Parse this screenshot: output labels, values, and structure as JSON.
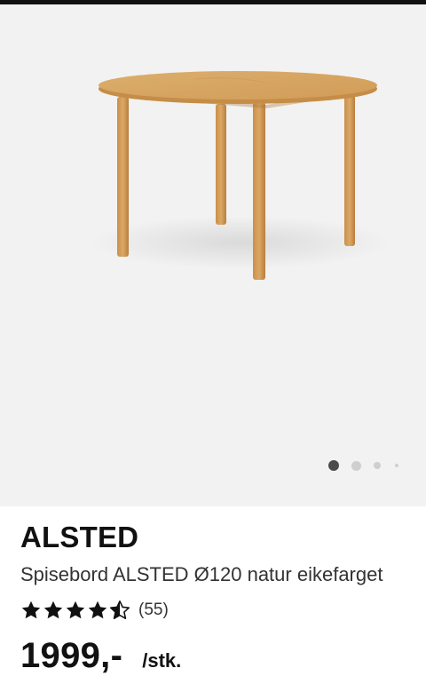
{
  "product": {
    "image_icon": "round-dining-table-image",
    "gallery_dots": [
      {
        "active": true
      },
      {
        "active": false
      },
      {
        "active": false
      },
      {
        "active": false
      }
    ],
    "brand": "ALSTED",
    "description": "Spisebord ALSTED Ø120 natur eikefarget",
    "rating": {
      "stars": 4.5,
      "max_stars": 5,
      "count_text": "(55)"
    },
    "price": "1999,-",
    "unit": "/stk."
  },
  "colors": {
    "gallery_background": "#f2f2f2",
    "active_dot": "#4a4a4a",
    "inactive_dot": "#cfcfcf",
    "wood": "#d6a25c"
  }
}
